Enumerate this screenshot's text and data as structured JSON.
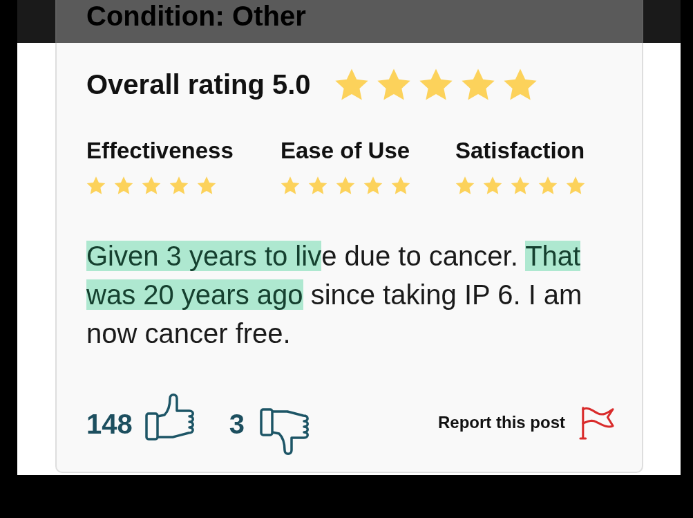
{
  "header": {
    "condition": "Condition: Other"
  },
  "review": {
    "overall": {
      "label": "Overall rating 5.0",
      "stars": 5
    },
    "ratings": [
      {
        "label": "Effectiveness",
        "stars": 5
      },
      {
        "label": "Ease of Use",
        "stars": 5
      },
      {
        "label": "Satisfaction",
        "stars": 5
      }
    ],
    "segments": [
      {
        "text": "Given 3 years to liv",
        "highlighted": true
      },
      {
        "text": "e due to cancer. ",
        "highlighted": false
      },
      {
        "text": "That was 20 years ago",
        "highlighted": true
      },
      {
        "text": " since taking IP 6. I am now cancer free.",
        "highlighted": false
      }
    ],
    "votes": {
      "helpful_count": "148",
      "unhelpful_count": "3"
    },
    "report": {
      "label": "Report this post"
    }
  }
}
